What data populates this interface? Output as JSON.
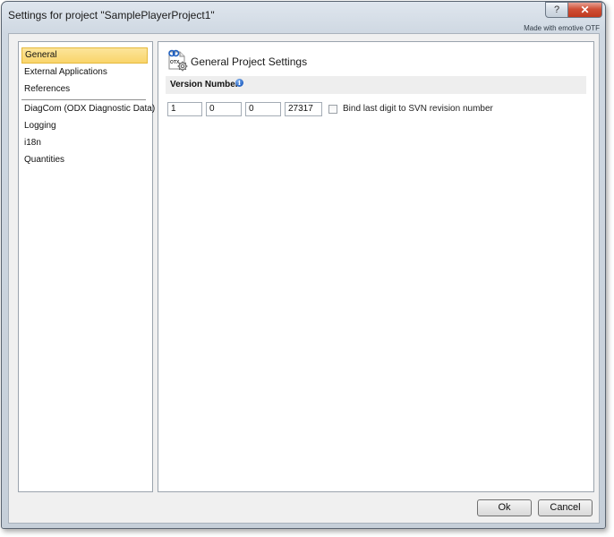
{
  "window": {
    "title": "Settings for project \"SamplePlayerProject1\"",
    "made_with": "Made with emotive OTF",
    "help_glyph": "?",
    "close_glyph": "✕"
  },
  "sidebar": {
    "items": [
      {
        "label": "General",
        "selected": true
      },
      {
        "label": "External Applications"
      },
      {
        "label": "References"
      },
      {
        "label": "DiagCom (ODX Diagnostic Data)"
      },
      {
        "label": "Logging"
      },
      {
        "label": "i18n"
      },
      {
        "label": "Quantities"
      }
    ]
  },
  "page": {
    "title": "General Project Settings",
    "icon_label": "OTX",
    "section": {
      "title": "Version Number",
      "info_glyph": "i"
    },
    "version": {
      "major": "1",
      "minor": "0",
      "patch": "0",
      "build": "27317"
    },
    "bind_svn_label": "Bind last digit to SVN revision number",
    "bind_svn_checked": false
  },
  "buttons": {
    "ok": "Ok",
    "cancel": "Cancel"
  },
  "colors": {
    "selection": "#f9d56b",
    "close_button": "#c0391e",
    "accent": "#2463c4"
  }
}
